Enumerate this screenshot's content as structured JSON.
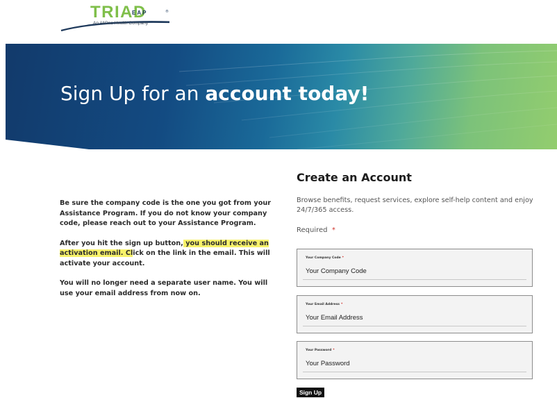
{
  "logo": {
    "name": "TRIAD",
    "suffix": "EAP",
    "tm": "®",
    "tagline": "An AllOne Health Company"
  },
  "banner": {
    "title_plain": "Sign Up for an ",
    "title_bold": "account today!"
  },
  "info": {
    "para1": "Be sure the company code is the one you got from your Assistance Program. If you do not know your company code, please reach out to your Assistance Program.",
    "para2_before": "After you hit the sign up button,",
    "para2_highlight": " you should receive an activation email. Cl",
    "para2_after": "ick on the link in the email. This will activate your account.",
    "para3": "You will no longer need a separate user name. You will use your email address from now on."
  },
  "form": {
    "title": "Create an Account",
    "description": "Browse benefits, request services, explore self-help content and enjoy 24/7/365 access.",
    "required_label": "Required",
    "required_star": "*",
    "fields": [
      {
        "label": "Your Company Code",
        "star": "*",
        "placeholder": "Your Company Code",
        "value": ""
      },
      {
        "label": "Your Email Address",
        "star": "*",
        "placeholder": "Your Email Address",
        "value": ""
      },
      {
        "label": "Your Password",
        "star": "*",
        "placeholder": "Your Password",
        "value": ""
      }
    ],
    "submit_label": "Sign Up"
  },
  "colors": {
    "brand_green": "#7fbf4a",
    "brand_navy": "#1f3a5c",
    "banner_start": "#123a6b",
    "banner_end": "#93cd6e",
    "highlight": "#f7f26a",
    "required_red": "#d0342c",
    "button_bg": "#111111"
  }
}
